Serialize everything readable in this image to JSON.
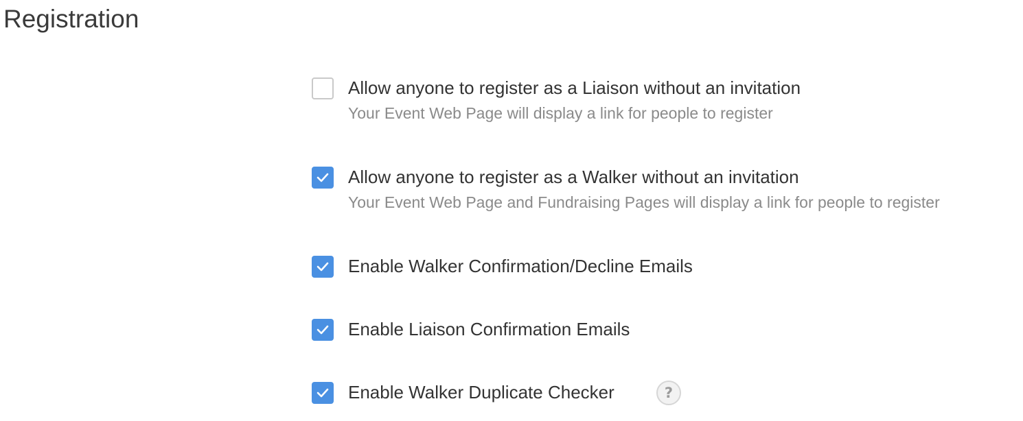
{
  "section": {
    "title": "Registration"
  },
  "options": [
    {
      "label": "Allow anyone to register as a Liaison without an invitation",
      "description": "Your Event Web Page will display a link for people to register",
      "checked": false
    },
    {
      "label": "Allow anyone to register as a Walker without an invitation",
      "description": "Your Event Web Page and Fundraising Pages will display a link for people to register",
      "checked": true
    },
    {
      "label": "Enable Walker Confirmation/Decline Emails",
      "checked": true
    },
    {
      "label": "Enable Liaison Confirmation Emails",
      "checked": true
    },
    {
      "label": "Enable Walker Duplicate Checker",
      "checked": true,
      "help_icon": "question-mark-icon",
      "help_glyph": "?"
    }
  ],
  "colors": {
    "checkbox_checked": "#4a90e2",
    "checkbox_unchecked_border": "#c9c9c9",
    "label_text": "#333333",
    "description_text": "#8a8a8a"
  }
}
